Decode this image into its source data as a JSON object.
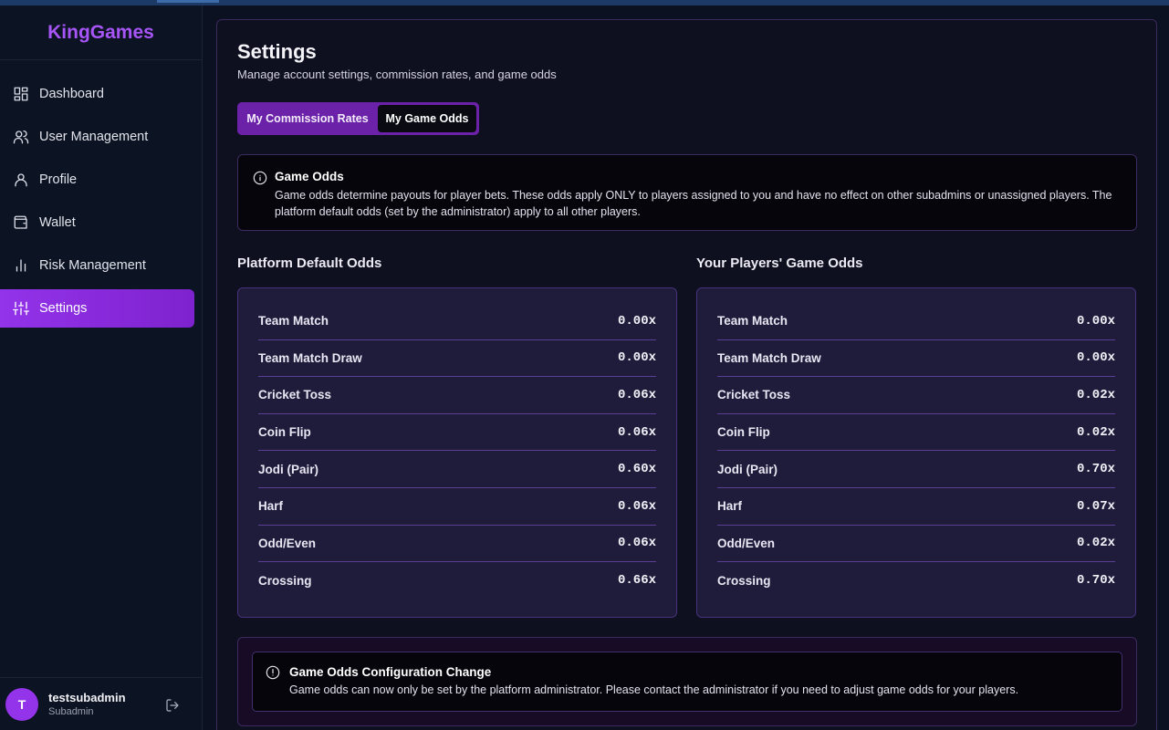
{
  "brand": "KingGames",
  "nav": [
    {
      "label": "Dashboard",
      "icon": "dashboard-icon",
      "active": false
    },
    {
      "label": "User Management",
      "icon": "users-icon",
      "active": false
    },
    {
      "label": "Profile",
      "icon": "user-icon",
      "active": false
    },
    {
      "label": "Wallet",
      "icon": "wallet-icon",
      "active": false
    },
    {
      "label": "Risk Management",
      "icon": "bar-chart-icon",
      "active": false
    },
    {
      "label": "Settings",
      "icon": "sliders-icon",
      "active": true
    }
  ],
  "user": {
    "initial": "T",
    "name": "testsubadmin",
    "role": "Subadmin"
  },
  "page": {
    "title": "Settings",
    "subtitle": "Manage account settings, commission rates, and game odds",
    "tabs": [
      {
        "label": "My Commission Rates",
        "active": false
      },
      {
        "label": "My Game Odds",
        "active": true
      }
    ]
  },
  "info": {
    "title": "Game Odds",
    "text": "Game odds determine payouts for player bets. These odds apply ONLY to players assigned to you and have no effect on other subadmins or unassigned players. The platform default odds (set by the administrator) apply to all other players."
  },
  "platform_odds": {
    "title": "Platform Default Odds",
    "rows": [
      {
        "name": "Team Match",
        "value": "0.00x"
      },
      {
        "name": "Team Match Draw",
        "value": "0.00x"
      },
      {
        "name": "Cricket Toss",
        "value": "0.06x"
      },
      {
        "name": "Coin Flip",
        "value": "0.06x"
      },
      {
        "name": "Jodi (Pair)",
        "value": "0.60x"
      },
      {
        "name": "Harf",
        "value": "0.06x"
      },
      {
        "name": "Odd/Even",
        "value": "0.06x"
      },
      {
        "name": "Crossing",
        "value": "0.66x"
      }
    ]
  },
  "player_odds": {
    "title": "Your Players' Game Odds",
    "rows": [
      {
        "name": "Team Match",
        "value": "0.00x"
      },
      {
        "name": "Team Match Draw",
        "value": "0.00x"
      },
      {
        "name": "Cricket Toss",
        "value": "0.02x"
      },
      {
        "name": "Coin Flip",
        "value": "0.02x"
      },
      {
        "name": "Jodi (Pair)",
        "value": "0.70x"
      },
      {
        "name": "Harf",
        "value": "0.07x"
      },
      {
        "name": "Odd/Even",
        "value": "0.02x"
      },
      {
        "name": "Crossing",
        "value": "0.70x"
      }
    ]
  },
  "notice": {
    "title": "Game Odds Configuration Change",
    "text": "Game odds can now only be set by the platform administrator. Please contact the administrator if you need to adjust game odds for your players."
  },
  "colors": {
    "accent": "#9333ea",
    "brand": "#a855f7",
    "card": "#1f1b3a"
  }
}
